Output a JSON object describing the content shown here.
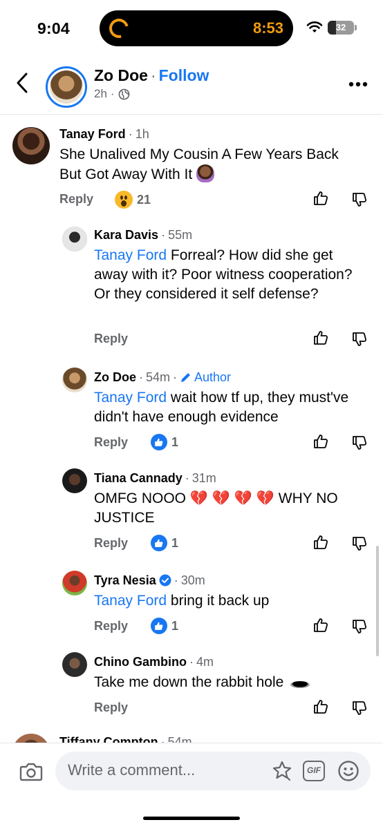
{
  "status_bar": {
    "time": "9:04",
    "island_time": "8:53",
    "battery": "32",
    "battery_level": 0.32
  },
  "header": {
    "name": "Zo Doe",
    "separator": "·",
    "follow_label": "Follow",
    "post_age": "2h",
    "dot": "·"
  },
  "comments": [
    {
      "name": "Tanay Ford",
      "time": "1h",
      "body": "She Unalived My Cousin A Few Years Back But Got Away With It",
      "reply_label": "Reply",
      "reaction_count": "21",
      "reaction": "wow"
    },
    {
      "name": "Kara Davis",
      "time": "55m",
      "mention": "Tanay Ford",
      "body": " Forreal? How did she get away with it? Poor witness cooperation? Or they considered it self defense?",
      "reply_label": "Reply"
    },
    {
      "name": "Zo Doe",
      "time": "54m",
      "author_label": "Author",
      "mention": "Tanay Ford",
      "body": " wait how tf up, they must've didn't have enough evidence",
      "reply_label": "Reply",
      "reaction_count": "1",
      "reaction": "like"
    },
    {
      "name": "Tiana Cannady",
      "time": "31m",
      "body": "OMFG NOOO 💔 💔 💔 💔 WHY NO JUSTICE",
      "reply_label": "Reply",
      "reaction_count": "1",
      "reaction": "like"
    },
    {
      "name": "Tyra Nesia",
      "time": "30m",
      "mention": "Tanay Ford",
      "body": " bring it back up",
      "reply_label": "Reply",
      "reaction_count": "1",
      "reaction": "like",
      "verified": true
    },
    {
      "name": "Chino Gambino",
      "time": "4m",
      "body": "Take me down the rabbit hole",
      "reply_label": "Reply"
    },
    {
      "name": "Tiffany Compton",
      "time": "54m"
    }
  ],
  "composer": {
    "placeholder": "Write a comment..."
  },
  "colors": {
    "link_blue": "#1877f2",
    "meta_gray": "#65676b",
    "island_orange": "#f29b12"
  }
}
